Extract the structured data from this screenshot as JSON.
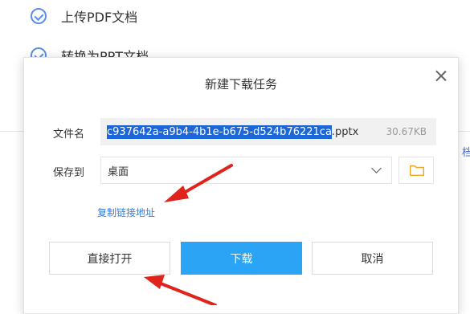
{
  "background": {
    "steps": [
      {
        "label": "上传PDF文档"
      },
      {
        "label": "转换为PPT文档"
      }
    ],
    "edge_text": "档"
  },
  "dialog": {
    "title": "新建下载任务",
    "filename_label": "文件名",
    "filename_selected": "c937642a-a9b4-4b1e-b675-d524b76221ca",
    "filename_ext": ".pptx",
    "file_size": "30.67KB",
    "save_to_label": "保存到",
    "save_to_value": "桌面",
    "copy_link": "复制链接地址",
    "buttons": {
      "open_direct": "直接打开",
      "download": "下载",
      "cancel": "取消"
    }
  },
  "colors": {
    "accent": "#2aa4f5",
    "selection": "#1c66d8",
    "link": "#2f7ce8",
    "arrow": "#e0231b"
  }
}
